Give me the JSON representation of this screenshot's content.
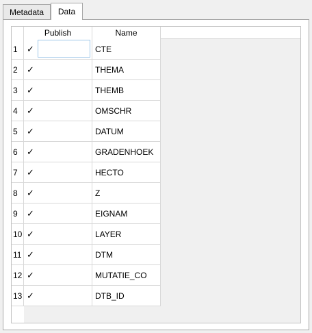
{
  "tabs": [
    {
      "label": "Metadata",
      "active": false
    },
    {
      "label": "Data",
      "active": true
    }
  ],
  "table": {
    "columns": [
      "Publish",
      "Name"
    ],
    "rows": [
      {
        "num": "1",
        "publish": true,
        "name": "CTE"
      },
      {
        "num": "2",
        "publish": true,
        "name": "THEMA"
      },
      {
        "num": "3",
        "publish": true,
        "name": "THEMB"
      },
      {
        "num": "4",
        "publish": true,
        "name": "OMSCHR"
      },
      {
        "num": "5",
        "publish": true,
        "name": "DATUM"
      },
      {
        "num": "6",
        "publish": true,
        "name": "GRADENHOEK"
      },
      {
        "num": "7",
        "publish": true,
        "name": "HECTO"
      },
      {
        "num": "8",
        "publish": true,
        "name": "Z"
      },
      {
        "num": "9",
        "publish": true,
        "name": "EIGNAM"
      },
      {
        "num": "10",
        "publish": true,
        "name": "LAYER"
      },
      {
        "num": "11",
        "publish": true,
        "name": "DTM"
      },
      {
        "num": "12",
        "publish": true,
        "name": "MUTATIE_CO"
      },
      {
        "num": "13",
        "publish": true,
        "name": "DTB_ID"
      }
    ]
  },
  "checkmark": "✓"
}
